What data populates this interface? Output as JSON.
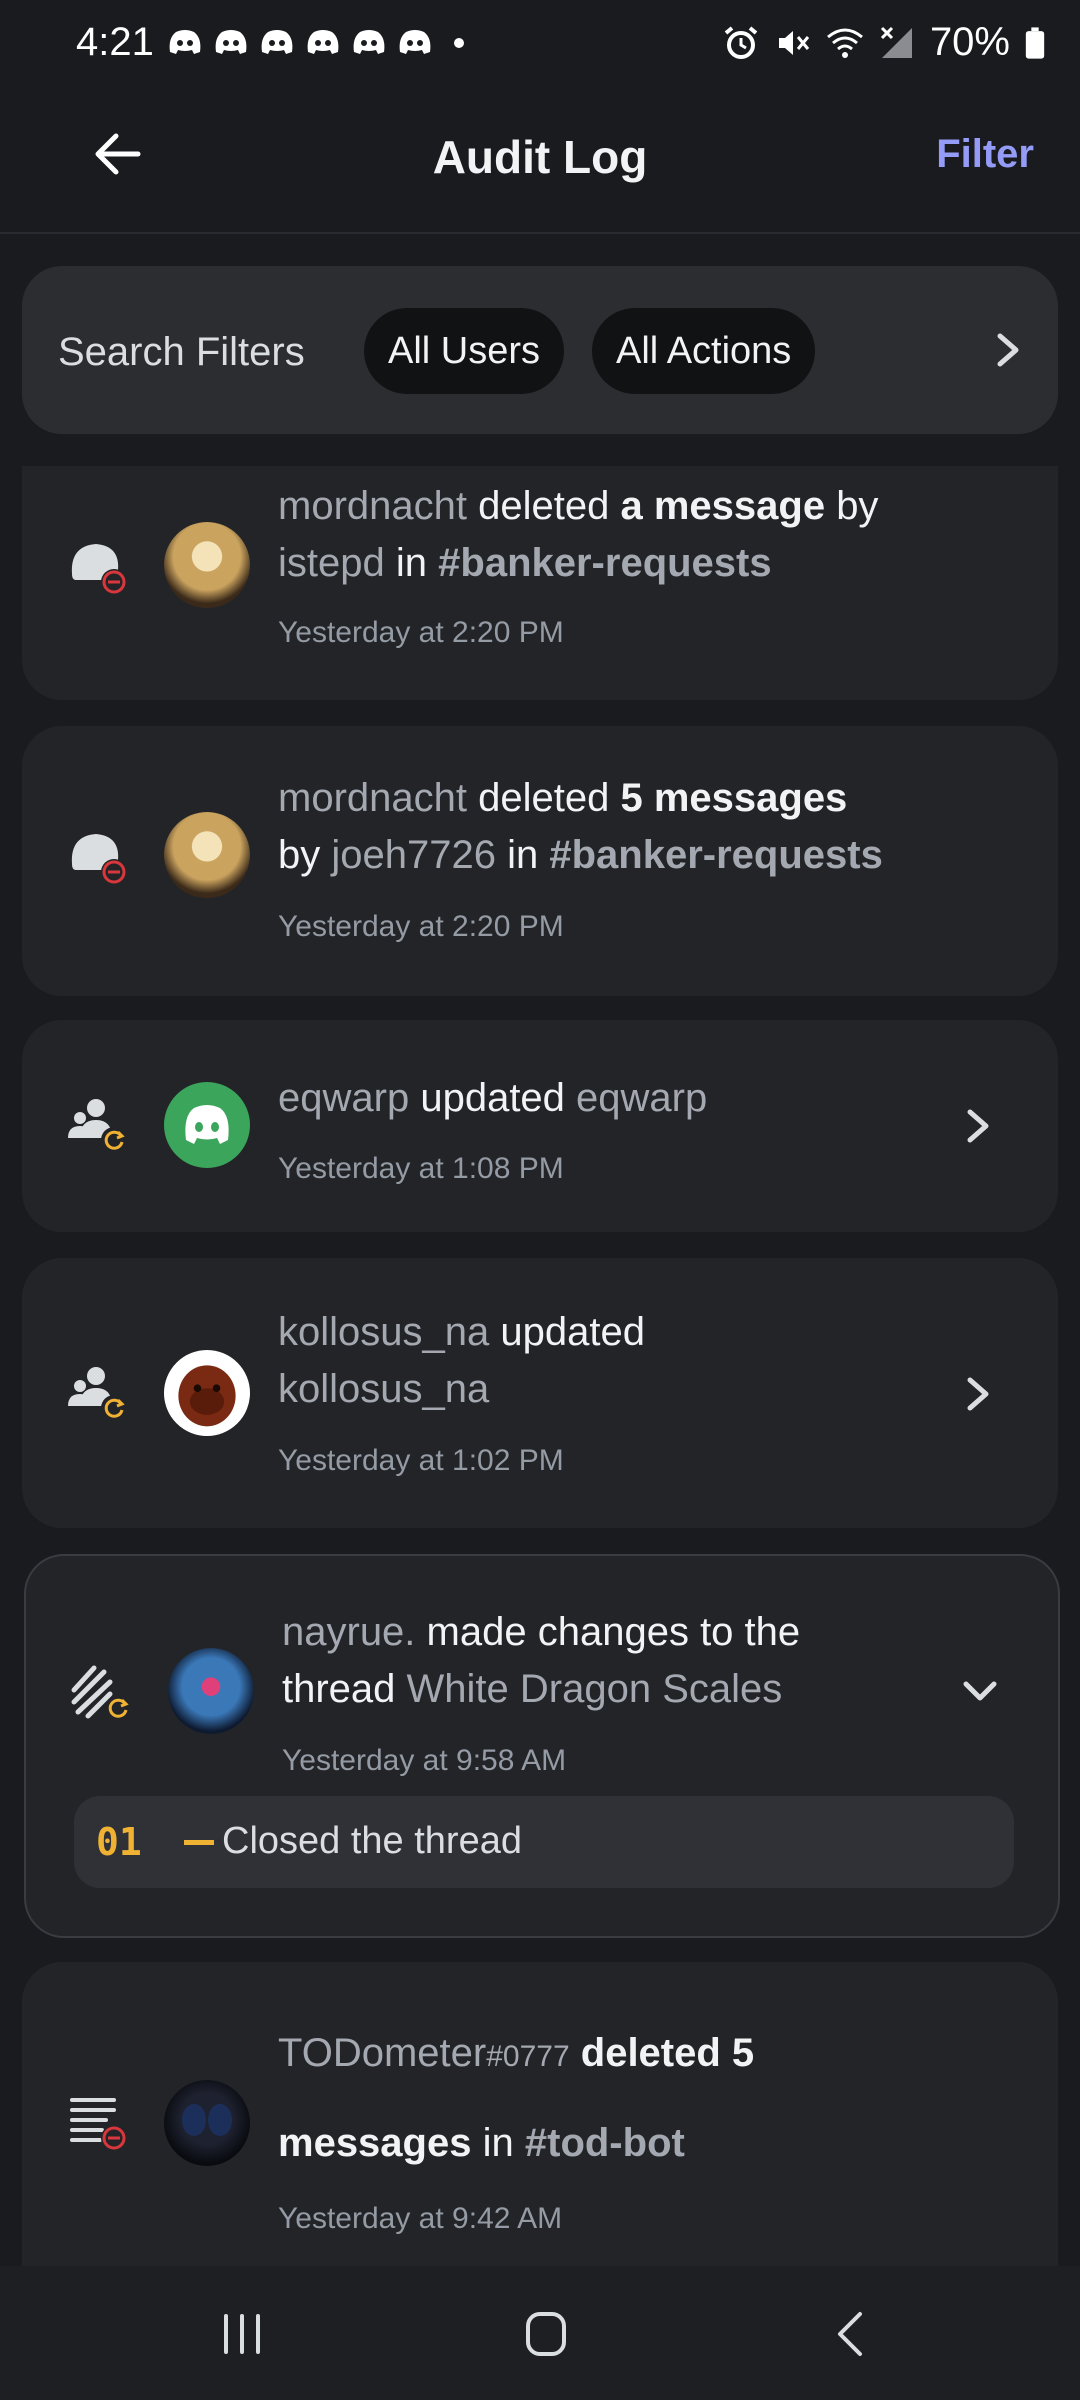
{
  "status_bar": {
    "time": "4:21",
    "battery": "70%",
    "notification_icons": [
      "discord-icon",
      "discord-icon",
      "discord-icon",
      "discord-icon",
      "discord-icon",
      "discord-icon"
    ],
    "system_icons": [
      "alarm-icon",
      "mute-icon",
      "wifi-icon",
      "signal-icon",
      "battery-icon"
    ]
  },
  "header": {
    "title": "Audit Log",
    "filter_label": "Filter"
  },
  "search_filters": {
    "label": "Search Filters",
    "users_chip": "All Users",
    "actions_chip": "All Actions"
  },
  "entries": [
    {
      "type_icon": "message-delete-icon",
      "actor": "mordnacht",
      "action": "deleted",
      "object": "a message",
      "by_word": "by",
      "target": "istepd",
      "in_word": "in",
      "channel": "#banker-requests",
      "time": "Yesterday at 2:20 PM"
    },
    {
      "type_icon": "message-delete-icon",
      "actor": "mordnacht",
      "action": "deleted",
      "object": "5 messages",
      "by_word": "by",
      "target": "joeh7726",
      "in_word": "in",
      "channel": "#banker-requests",
      "time": "Yesterday at 2:20 PM"
    },
    {
      "type_icon": "member-update-icon",
      "actor": "eqwarp",
      "action": "updated",
      "target": "eqwarp",
      "time": "Yesterday at 1:08 PM"
    },
    {
      "type_icon": "member-update-icon",
      "actor": "kollosus_na",
      "action": "updated",
      "target": "kollosus_na",
      "time": "Yesterday at 1:02 PM"
    },
    {
      "type_icon": "thread-update-icon",
      "actor": "nayrue.",
      "action": "made changes to the thread",
      "action_line1": "made changes to the",
      "action_line2": "thread",
      "target": "White Dragon Scales",
      "time": "Yesterday at 9:58 AM",
      "changes": [
        {
          "number": "01",
          "text": "Closed the thread"
        }
      ]
    },
    {
      "type_icon": "bulk-delete-icon",
      "actor": "TODometer",
      "actor_tag": "#0777",
      "action": "deleted 5",
      "action_line2": "messages",
      "in_word": "in",
      "channel": "#tod-bot",
      "time": "Yesterday at 9:42 AM"
    }
  ],
  "colors": {
    "background": "#1a1b1f",
    "card": "#232428",
    "accent": "#949cf7",
    "change_number": "#f0b232",
    "delete_badge": "#da373c",
    "update_badge": "#f0b232",
    "discord_avatar": "#3ba55c"
  },
  "nav_bar": {
    "buttons": [
      "recent-apps-icon",
      "home-icon",
      "back-icon"
    ]
  }
}
